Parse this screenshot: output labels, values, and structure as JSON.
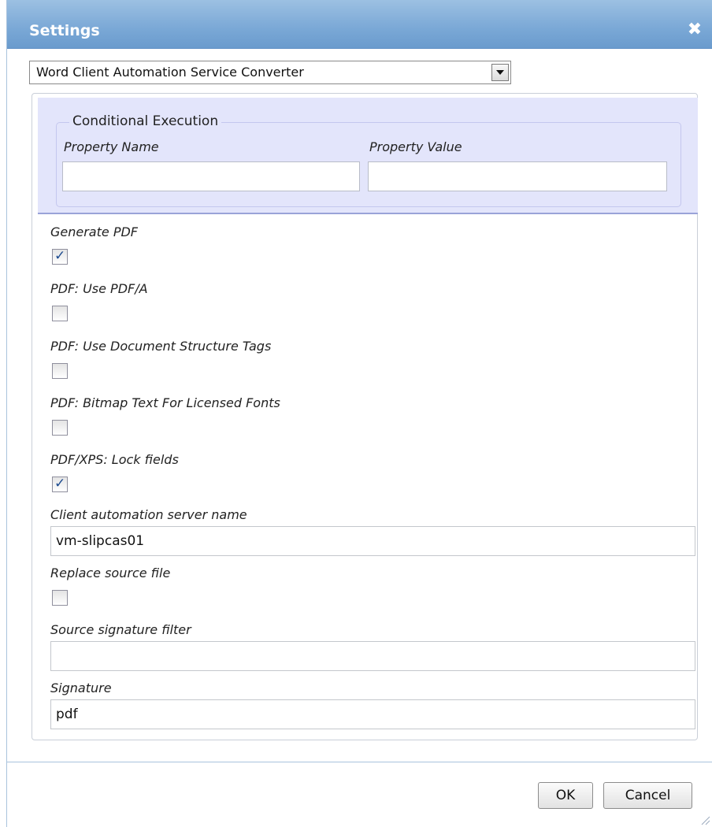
{
  "dialog": {
    "title": "Settings",
    "close_icon": "close-icon",
    "converter_select": {
      "selected": "Word Client Automation Service Converter"
    },
    "conditional_execution": {
      "legend": "Conditional Execution",
      "property_name_label": "Property Name",
      "property_name_value": "",
      "property_value_label": "Property Value",
      "property_value_value": ""
    },
    "options": [
      {
        "label": "Generate PDF",
        "checked": true
      },
      {
        "label": "PDF: Use PDF/A",
        "checked": false
      },
      {
        "label": "PDF: Use Document Structure Tags",
        "checked": false
      },
      {
        "label": "PDF: Bitmap Text For Licensed Fonts",
        "checked": false
      },
      {
        "label": "PDF/XPS: Lock fields",
        "checked": true
      }
    ],
    "client_server": {
      "label": "Client automation server name",
      "value": "vm-slipcas01"
    },
    "replace_source": {
      "label": "Replace source file",
      "checked": false
    },
    "source_filter": {
      "label": "Source signature filter",
      "value": ""
    },
    "signature": {
      "label": "Signature",
      "value": "pdf"
    },
    "buttons": {
      "ok": "OK",
      "cancel": "Cancel"
    },
    "check_glyph": "✓",
    "colors": {
      "titlebar": "#7aa8d6",
      "conditional_bg": "#e3e5fb",
      "check": "#1c4a8f"
    }
  }
}
